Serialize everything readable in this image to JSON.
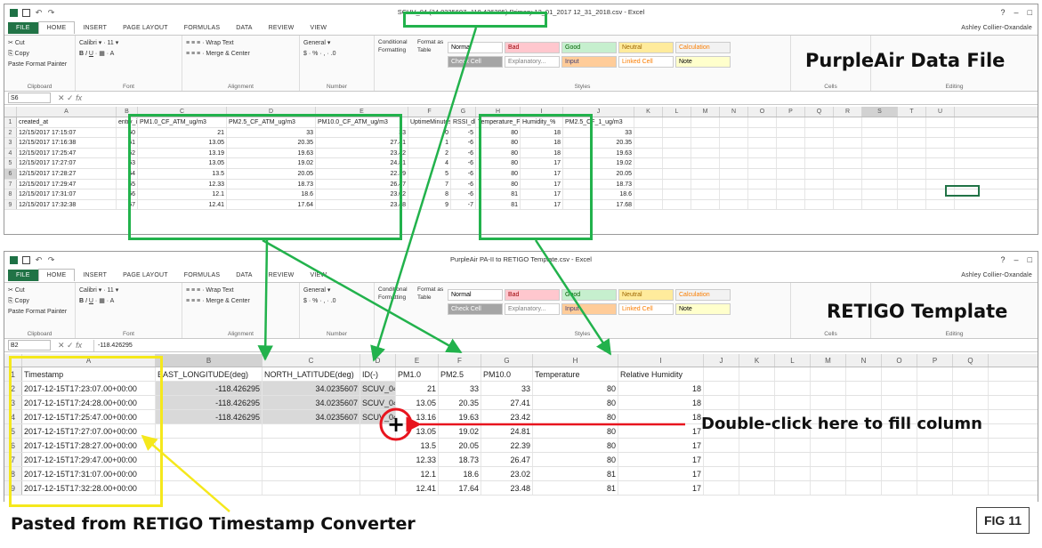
{
  "ribbon_common": {
    "tabs": [
      "FILE",
      "HOME",
      "INSERT",
      "PAGE LAYOUT",
      "FORMULAS",
      "DATA",
      "REVIEW",
      "VIEW"
    ],
    "clipboard": {
      "cut": "Cut",
      "copy": "Copy",
      "paste": "Paste",
      "format_painter": "Format Painter",
      "label": "Clipboard"
    },
    "font": {
      "name": "Calibri",
      "size": "11",
      "label": "Font"
    },
    "alignment": {
      "wrap": "Wrap Text",
      "merge": "Merge & Center",
      "label": "Alignment"
    },
    "number": {
      "format": "General",
      "label": "Number"
    },
    "conditional": "Conditional Formatting",
    "format_as_table": "Format as Table",
    "styles_label": "Styles",
    "cells_label": "Cells",
    "editing_label": "Editing",
    "styles": [
      {
        "label": "Normal",
        "bg": "#ffffff",
        "fg": "#000000"
      },
      {
        "label": "Bad",
        "bg": "#ffc7ce",
        "fg": "#9c0006"
      },
      {
        "label": "Good",
        "bg": "#c6efce",
        "fg": "#006100"
      },
      {
        "label": "Neutral",
        "bg": "#ffeb9c",
        "fg": "#9c6500"
      },
      {
        "label": "Calculation",
        "bg": "#f2f2f2",
        "fg": "#fa7d00"
      },
      {
        "label": "Check Cell",
        "bg": "#a5a5a5",
        "fg": "#ffffff"
      },
      {
        "label": "Explanatory...",
        "bg": "#ffffff",
        "fg": "#7f7f7f"
      },
      {
        "label": "Input",
        "bg": "#ffcc99",
        "fg": "#3f3f76"
      },
      {
        "label": "Linked Cell",
        "bg": "#ffffff",
        "fg": "#fa7d00"
      },
      {
        "label": "Note",
        "bg": "#ffffcc",
        "fg": "#000000"
      }
    ]
  },
  "top_window": {
    "title": "SCUV_04 (34.0235607 -118.426295) Primary 12_01_2017 12_31_2018.csv - Excel",
    "user": "Ashley Collier-Oxandale",
    "namebox": "S6",
    "formula": "",
    "label": "PurpleAir Data File",
    "columns": [
      "A",
      "B",
      "C",
      "D",
      "E",
      "F",
      "G",
      "H",
      "I",
      "J",
      "K",
      "L",
      "M",
      "N",
      "O",
      "P",
      "Q",
      "R",
      "S",
      "T",
      "U"
    ],
    "headers": [
      "created_at",
      "entry_id",
      "PM1.0_CF_ATM_ug/m3",
      "PM2.5_CF_ATM_ug/m3",
      "PM10.0_CF_ATM_ug/m3",
      "UptimeMinutes",
      "RSSI_dbm",
      "Temperature_F",
      "Humidity_%",
      "PM2.5_CF_1_ug/m3"
    ],
    "rows": [
      [
        "12/15/2017 17:15:07",
        "50",
        "21",
        "33",
        "33",
        "0",
        "-5",
        "80",
        "18",
        "33"
      ],
      [
        "12/15/2017 17:16:38",
        "51",
        "13.05",
        "20.35",
        "27.41",
        "1",
        "-6",
        "80",
        "18",
        "20.35"
      ],
      [
        "12/15/2017 17:25:47",
        "52",
        "13.19",
        "19.63",
        "23.42",
        "2",
        "-6",
        "80",
        "18",
        "19.63"
      ],
      [
        "12/15/2017 17:27:07",
        "53",
        "13.05",
        "19.02",
        "24.81",
        "4",
        "-6",
        "80",
        "17",
        "19.02"
      ],
      [
        "12/15/2017 17:28:27",
        "54",
        "13.5",
        "20.05",
        "22.39",
        "5",
        "-6",
        "80",
        "17",
        "20.05"
      ],
      [
        "12/15/2017 17:29:47",
        "55",
        "12.33",
        "18.73",
        "26.47",
        "7",
        "-6",
        "80",
        "17",
        "18.73"
      ],
      [
        "12/15/2017 17:31:07",
        "56",
        "12.1",
        "18.6",
        "23.02",
        "8",
        "-6",
        "81",
        "17",
        "18.6"
      ],
      [
        "12/15/2017 17:32:38",
        "57",
        "12.41",
        "17.64",
        "23.48",
        "9",
        "-7",
        "81",
        "17",
        "17.68"
      ]
    ]
  },
  "bottom_window": {
    "title": "PurpleAir PA-II to RETIGO Template.csv - Excel",
    "user": "Ashley Collier-Oxandale",
    "namebox": "B2",
    "formula": "-118.426295",
    "label": "RETIGO Template",
    "columns": [
      "A",
      "B",
      "C",
      "D",
      "E",
      "F",
      "G",
      "H",
      "I",
      "J",
      "K",
      "L",
      "M",
      "N",
      "O",
      "P",
      "Q"
    ],
    "headers": [
      "Timestamp",
      "EAST_LONGITUDE(deg)",
      "NORTH_LATITUDE(deg)",
      "ID(-)",
      "PM1.0",
      "PM2.5",
      "PM10.0",
      "Temperature",
      "Relative Humidity"
    ],
    "rows": [
      [
        "2017-12-15T17:23:07.00+00:00",
        "-118.426295",
        "34.0235607",
        "SCUV_04",
        "21",
        "33",
        "33",
        "80",
        "18"
      ],
      [
        "2017-12-15T17:24:28.00+00:00",
        "-118.426295",
        "34.0235607",
        "SCUV_04",
        "13.05",
        "20.35",
        "27.41",
        "80",
        "18"
      ],
      [
        "2017-12-15T17:25:47.00+00:00",
        "-118.426295",
        "34.0235607",
        "SCUV_04",
        "13.16",
        "19.63",
        "23.42",
        "80",
        "18"
      ],
      [
        "2017-12-15T17:27:07.00+00:00",
        "",
        "",
        "",
        "13.05",
        "19.02",
        "24.81",
        "80",
        "17"
      ],
      [
        "2017-12-15T17:28:27.00+00:00",
        "",
        "",
        "",
        "13.5",
        "20.05",
        "22.39",
        "80",
        "17"
      ],
      [
        "2017-12-15T17:29:47.00+00:00",
        "",
        "",
        "",
        "12.33",
        "18.73",
        "26.47",
        "80",
        "17"
      ],
      [
        "2017-12-15T17:31:07.00+00:00",
        "",
        "",
        "",
        "12.1",
        "18.6",
        "23.02",
        "81",
        "17"
      ],
      [
        "2017-12-15T17:32:28.00+00:00",
        "",
        "",
        "",
        "12.41",
        "17.64",
        "23.48",
        "81",
        "17"
      ]
    ]
  },
  "annotations": {
    "instruction": "Double-click here to fill column",
    "pasted_from": "Pasted from RETIGO Timestamp Converter",
    "figure_label": "FIG 11",
    "highlight_green": "#22b24c",
    "highlight_yellow": "#f5e81c",
    "arrow_red": "#e8141e"
  }
}
